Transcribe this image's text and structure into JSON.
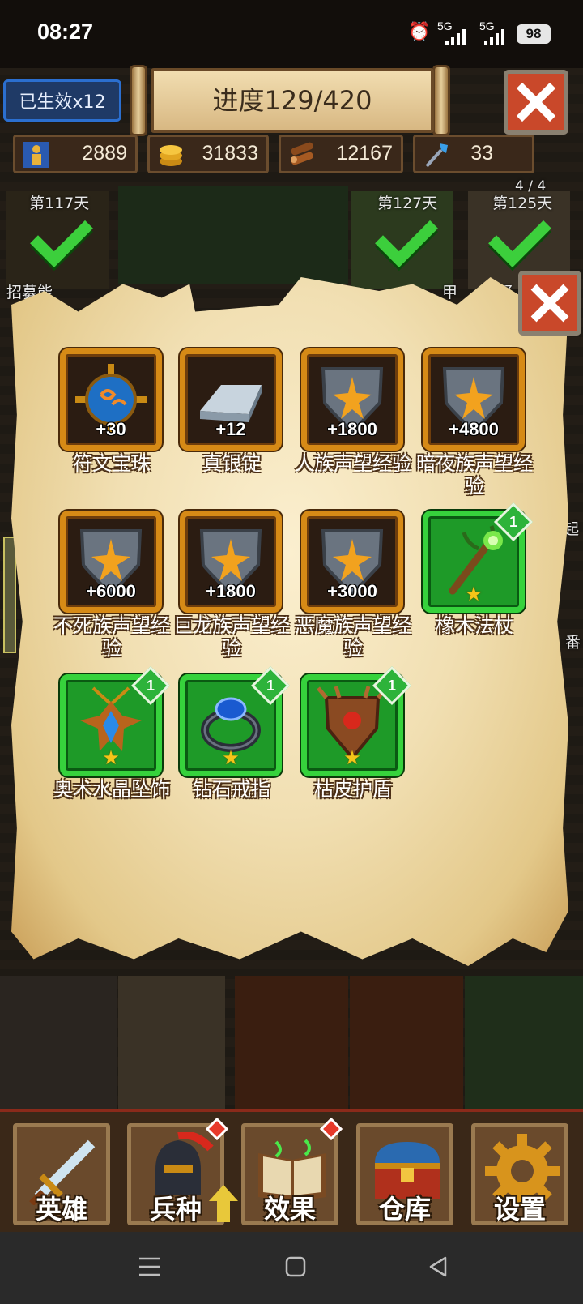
{
  "status_bar": {
    "time": "08:27",
    "alarm_icon": "alarm-icon",
    "signal1": "5G",
    "signal2": "5G",
    "battery": "98"
  },
  "hud": {
    "effects_label": "已生效x12",
    "progress": "进度129/420",
    "resources": [
      {
        "icon": "population-icon",
        "value": "2889"
      },
      {
        "icon": "gold-coins-icon",
        "value": "31833"
      },
      {
        "icon": "wood-logs-icon",
        "value": "12167"
      },
      {
        "icon": "magic-wand-icon",
        "value": "33"
      }
    ]
  },
  "background": {
    "day_labels": [
      "第117天",
      "第127天",
      "第125天"
    ],
    "page_counter": "4 / 4",
    "partial_labels": [
      "招募能",
      "甲",
      "野",
      "起",
      "番"
    ]
  },
  "popup": {
    "items": [
      {
        "name": "符文宝珠",
        "qty": "+30",
        "frame": "gold",
        "icon": "rune-orb-icon"
      },
      {
        "name": "真银锭",
        "qty": "+12",
        "frame": "gold",
        "icon": "silver-ingot-icon"
      },
      {
        "name": "人族声望经验",
        "qty": "+1800",
        "frame": "gold",
        "icon": "reputation-shield-icon"
      },
      {
        "name": "暗夜族声望经验",
        "qty": "+4800",
        "frame": "gold",
        "icon": "reputation-shield-icon"
      },
      {
        "name": "不死族声望经验",
        "qty": "+6000",
        "frame": "gold",
        "icon": "reputation-shield-icon"
      },
      {
        "name": "巨龙族声望经验",
        "qty": "+1800",
        "frame": "gold",
        "icon": "reputation-shield-icon"
      },
      {
        "name": "恶魔族声望经验",
        "qty": "+3000",
        "frame": "gold",
        "icon": "reputation-shield-icon"
      },
      {
        "name": "橡木法杖",
        "badge": "1",
        "stars": "★",
        "frame": "green",
        "icon": "oak-staff-icon"
      },
      {
        "name": "奥术水晶坠饰",
        "badge": "1",
        "stars": "★",
        "frame": "green",
        "icon": "crystal-pendant-icon"
      },
      {
        "name": "钻石戒指",
        "badge": "1",
        "stars": "★",
        "frame": "green",
        "icon": "diamond-ring-icon"
      },
      {
        "name": "枯皮护盾",
        "badge": "1",
        "stars": "★",
        "frame": "green",
        "icon": "bark-shield-icon"
      }
    ]
  },
  "dock": [
    {
      "label": "英雄",
      "icon": "sword-icon"
    },
    {
      "label": "兵种",
      "icon": "knight-helmet-icon"
    },
    {
      "label": "效果",
      "icon": "spellbook-icon"
    },
    {
      "label": "仓库",
      "icon": "treasure-chest-icon"
    },
    {
      "label": "设置",
      "icon": "gear-icon"
    }
  ],
  "colors": {
    "gold_frame": "#d68a16",
    "green_frame": "#36d23c",
    "close_red": "#c9482a",
    "parchment": "#f1dfb2"
  }
}
